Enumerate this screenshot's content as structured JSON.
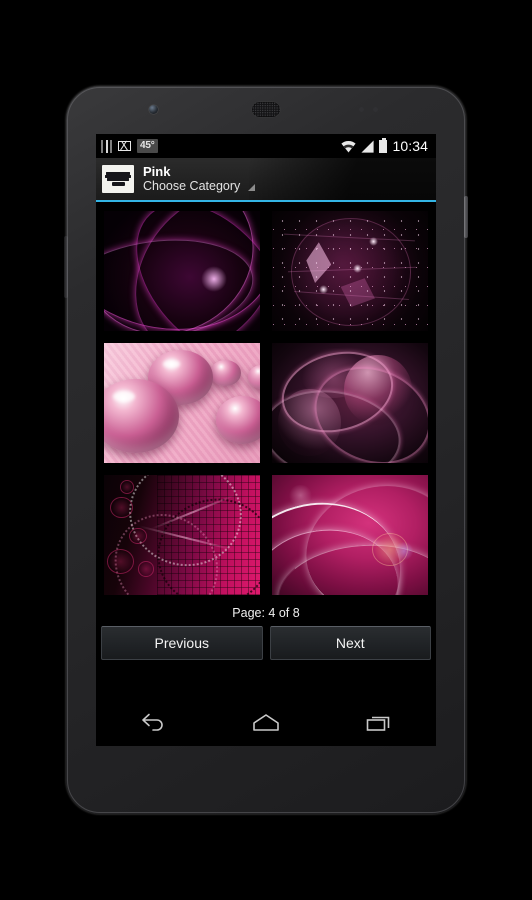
{
  "device": {
    "name": "android-phone"
  },
  "status_bar": {
    "notification_icon": "notification-icon",
    "mail_icon": "gmail-icon",
    "temperature": "45°",
    "wifi_icon": "wifi-icon",
    "signal_icon": "signal-bars-icon",
    "battery_icon": "battery-icon",
    "clock": "10:34"
  },
  "action_bar": {
    "logo": "app-logo-icon",
    "title": "Pink",
    "subtitle": "Choose Category",
    "spinner_icon": "dropdown-triangle-icon",
    "accent_color": "#33b5e5"
  },
  "gallery": {
    "items": [
      {
        "id": 1,
        "alt": "Magenta fractal light streaks on black"
      },
      {
        "id": 2,
        "alt": "Dark pink polygonal globe with particle stars"
      },
      {
        "id": 3,
        "alt": "Glossy pink spheres on striped pink background"
      },
      {
        "id": 4,
        "alt": "Abstract 3D glossy pink curved surfaces"
      },
      {
        "id": 5,
        "alt": "Hot pink dotted spirals with bokeh and halftone grid"
      },
      {
        "id": 6,
        "alt": "Pink waves with white light ribbons and lens flares"
      }
    ]
  },
  "pager": {
    "label": "Page: 4 of 8",
    "current_page": 4,
    "total_pages": 8,
    "previous_label": "Previous",
    "next_label": "Next"
  },
  "nav_bar": {
    "back_icon": "back-arrow-icon",
    "home_icon": "home-icon",
    "recents_icon": "recent-apps-icon"
  }
}
